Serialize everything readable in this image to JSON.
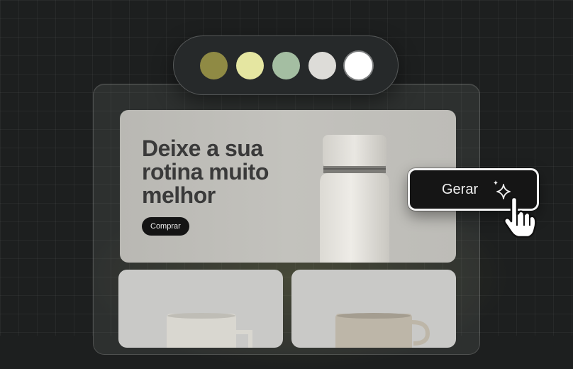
{
  "palette": {
    "swatches": [
      {
        "color": "#8f8a44"
      },
      {
        "color": "#e5e6a1"
      },
      {
        "color": "#a4bea2"
      },
      {
        "color": "#dddcd8"
      },
      {
        "color": "#ffffff"
      }
    ]
  },
  "hero": {
    "title_lines": [
      "Deixe a sua",
      "rotina muito",
      "melhor"
    ],
    "cta_label": "Comprar"
  },
  "generate_button": {
    "label": "Gerar",
    "icon": "sparkle-icon"
  },
  "cursor": {
    "icon": "hand-pointer-icon"
  },
  "colors": {
    "background": "#1d1f1f",
    "hero_background": "#bdbcb7",
    "title_text": "#3a3a3a",
    "button_dark": "#151515"
  }
}
